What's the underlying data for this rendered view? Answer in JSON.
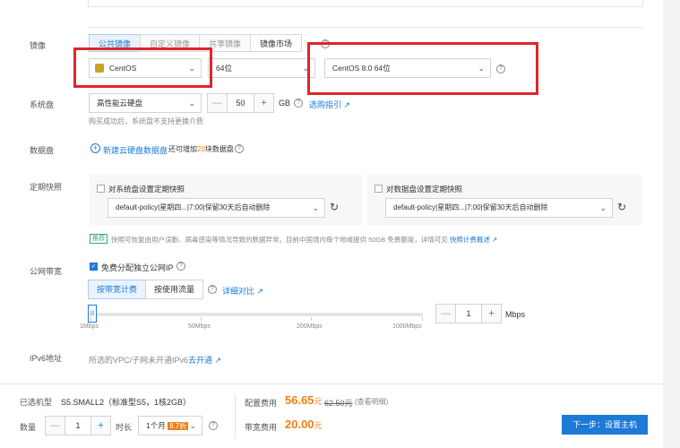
{
  "image": {
    "label": "镜像",
    "tabs": [
      {
        "label": "公共镜像",
        "active": true
      },
      {
        "label": "自定义镜像",
        "active": false
      },
      {
        "label": "共享镜像",
        "active": false
      },
      {
        "label": "镜像市场",
        "active": false
      }
    ],
    "os_select": "CentOS",
    "bits_select": "64位",
    "version_select": "CentOS 8.0 64位",
    "help_icon": "?"
  },
  "system_disk": {
    "label": "系统盘",
    "type_select": "高性能云硬盘",
    "size_value": "50",
    "unit": "GB",
    "guide_link": "选购指引",
    "note": "购买成功后，系统盘不支持更换介质"
  },
  "data_disk": {
    "label": "数据盘",
    "add_link": "新建云硬盘数据盘",
    "remaining_prefix": "还可增加",
    "remaining_count": "20",
    "remaining_suffix": "块数据盘"
  },
  "snapshot": {
    "label": "定期快照",
    "system_checkbox": "对系统盘设置定期快照",
    "system_policy": "default-policy|星期四...|7:00|保留30天后自动删除",
    "data_checkbox": "对数据盘设置定期快照",
    "data_policy": "default-policy|星期四...|7:00|保留30天后自动删除",
    "tag": "推荐",
    "note": "快照可恢复由用户误删、病毒感染等情况导致的数据异常。目前中国境内每个地域提供 50GB 免费额度，详情可见",
    "billing_link": "快照计费概述"
  },
  "bandwidth": {
    "label": "公网带宽",
    "free_ip_checkbox": "免费分配独立公网IP",
    "tabs": [
      {
        "label": "按带宽计费",
        "active": true
      },
      {
        "label": "按使用流量",
        "active": false
      }
    ],
    "compare_link": "详细对比",
    "slider_ticks": [
      "1Mbps",
      "50Mbps",
      "200Mbps",
      "1000Mbps"
    ],
    "slider_thumb": "|||",
    "value": "1",
    "unit": "Mbps"
  },
  "ipv6": {
    "label": "IPv6地址",
    "note": "所选的VPC/子网未开通IPv6",
    "enable_link": "去开通"
  },
  "footer": {
    "selected_model_label": "已选机型",
    "selected_model_value": "S5.SMALL2（标准型S5，1核2GB）",
    "quantity_label": "数量",
    "quantity_value": "1",
    "duration_label": "时长",
    "duration_value": "1个月",
    "discount_badge": "8.7折",
    "config_fee_label": "配置费用",
    "config_fee_price": "56.65",
    "config_fee_unit": "元",
    "config_fee_original": "62.50元",
    "config_fee_detail": "(查看明细)",
    "bandwidth_fee_label": "带宽费用",
    "bandwidth_fee_price": "20.00",
    "bandwidth_fee_unit": "元",
    "next_button": "下一步：设置主机"
  },
  "colors": {
    "accent": "#1d7ad6",
    "highlight": "#e0242b",
    "price": "#f07f13"
  }
}
